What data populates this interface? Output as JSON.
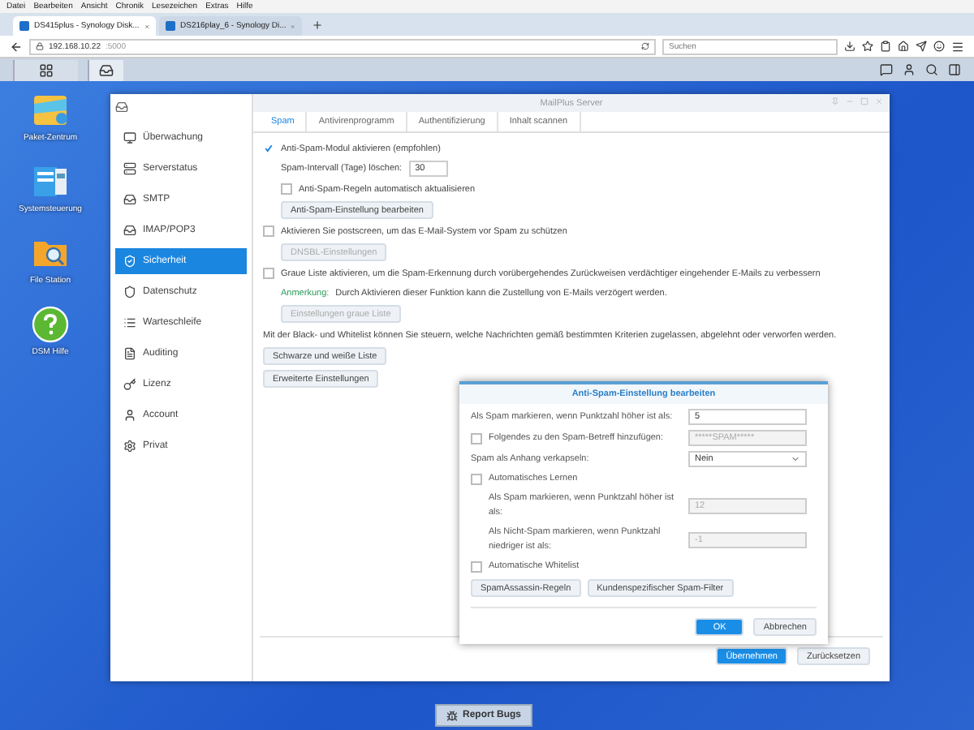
{
  "browser": {
    "menu": [
      "Datei",
      "Bearbeiten",
      "Ansicht",
      "Chronik",
      "Lesezeichen",
      "Extras",
      "Hilfe"
    ],
    "tabs": [
      {
        "label": "DS415plus - Synology Disk...",
        "selected": true
      },
      {
        "label": "DS216play_6 - Synology Di...",
        "selected": false
      }
    ],
    "address": {
      "host": "192.168.10.22",
      "port": ":5000"
    },
    "search": {
      "placeholder": "Suchen"
    }
  },
  "desktop": {
    "icons": [
      {
        "label": "Paket-Zentrum",
        "kind": "package"
      },
      {
        "label": "Systemsteuerung",
        "kind": "control"
      },
      {
        "label": "File Station",
        "kind": "folder"
      },
      {
        "label": "DSM Hilfe",
        "kind": "help"
      }
    ]
  },
  "window": {
    "title": "MailPlus Server",
    "sidebar": [
      {
        "label": "Überwachung",
        "selected": false
      },
      {
        "label": "Serverstatus",
        "selected": false
      },
      {
        "label": "SMTP",
        "selected": false
      },
      {
        "label": "IMAP/POP3",
        "selected": false
      },
      {
        "label": "Sicherheit",
        "selected": true
      },
      {
        "label": "Datenschutz",
        "selected": false
      },
      {
        "label": "Warteschleife",
        "selected": false
      },
      {
        "label": "Auditing",
        "selected": false
      },
      {
        "label": "Lizenz",
        "selected": false
      },
      {
        "label": "Account",
        "selected": false
      },
      {
        "label": "Privat",
        "selected": false
      }
    ],
    "tabs": [
      {
        "label": "Spam",
        "selected": true
      },
      {
        "label": "Antivirenprogramm",
        "selected": false
      },
      {
        "label": "Authentifizierung",
        "selected": false
      },
      {
        "label": "Inhalt scannen",
        "selected": false
      }
    ],
    "settings": [
      {
        "kind": "checkbox",
        "label": "Anti-Spam-Modul aktivieren (empfohlen)",
        "checked": true,
        "children": [
          {
            "kind": "field",
            "label": "Spam-Intervall (Tage) löschen:",
            "value": "30"
          },
          {
            "kind": "checkbox",
            "label": "Anti-Spam-Regeln automatisch aktualisieren",
            "checked": false
          },
          {
            "kind": "button",
            "label": "Anti-Spam-Einstellung bearbeiten",
            "disabled": false
          }
        ]
      },
      {
        "kind": "checkbox",
        "label": "Aktivieren Sie postscreen, um das E-Mail-System vor Spam zu schützen",
        "checked": false,
        "children": [
          {
            "kind": "button",
            "label": "DNSBL-Einstellungen",
            "disabled": true
          }
        ]
      },
      {
        "kind": "checkbox",
        "label": "Graue Liste aktivieren, um die Spam-Erkennung durch vorübergehendes Zurückweisen verdächtiger eingehender E-Mails zu verbessern",
        "checked": false,
        "children": [
          {
            "kind": "note",
            "label": "Anmerkung:",
            "text": "Durch Aktivieren dieser Funktion kann die Zustellung von E-Mails verzögert werden."
          },
          {
            "kind": "button",
            "label": "Einstellungen graue Liste",
            "disabled": true
          }
        ]
      },
      {
        "kind": "text",
        "text": "Mit der Black- und Whitelist können Sie steuern, welche Nachrichten gemäß bestimmten Kriterien zugelassen, abgelehnt oder verworfen werden."
      },
      {
        "kind": "button",
        "label": "Schwarze und weiße Liste",
        "disabled": false
      },
      {
        "kind": "button",
        "label": "Erweiterte Einstellungen",
        "disabled": false
      }
    ],
    "footer": [
      {
        "label": "Übernehmen",
        "primary": true
      },
      {
        "label": "Zurücksetzen",
        "primary": false
      }
    ]
  },
  "dialog": {
    "title": "Anti-Spam-Einstellung bearbeiten",
    "rows": [
      {
        "kind": "field",
        "label": "Als Spam markieren, wenn Punktzahl höher ist als:",
        "value": "5",
        "disabled": false
      },
      {
        "kind": "checkfield",
        "label": "Folgendes zu den Spam-Betreff hinzufügen:",
        "checked": false,
        "value": "*****SPAM*****",
        "disabled": true
      },
      {
        "kind": "select",
        "label": "Spam als Anhang verkapseln:",
        "value": "Nein"
      },
      {
        "kind": "checkbox",
        "label": "Automatisches Lernen",
        "checked": false,
        "children": [
          {
            "kind": "field",
            "label": "Als Spam markieren, wenn Punktzahl höher ist als:",
            "value": "12",
            "disabled": true
          },
          {
            "kind": "field",
            "label": "Als Nicht-Spam markieren, wenn Punktzahl niedriger ist als:",
            "value": "-1",
            "disabled": true
          }
        ]
      },
      {
        "kind": "checkbox",
        "label": "Automatische Whitelist",
        "checked": false
      }
    ],
    "buttons": [
      "SpamAssassin-Regeln",
      "Kundenspezifischer Spam-Filter"
    ],
    "footer": [
      {
        "label": "OK",
        "primary": true
      },
      {
        "label": "Abbrechen",
        "primary": false
      }
    ]
  },
  "report_button": "Report Bugs"
}
